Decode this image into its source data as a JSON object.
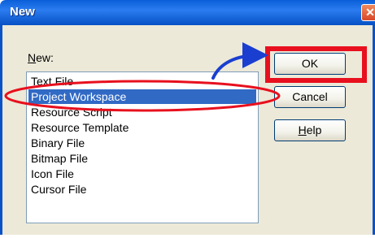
{
  "window": {
    "title": "New",
    "close_glyph": "✕"
  },
  "dialog": {
    "new_label_prefix": "N",
    "new_label_rest": "ew:",
    "list_items": [
      "Text File",
      "Project Workspace",
      "Resource Script",
      "Resource Template",
      "Binary File",
      "Bitmap File",
      "Icon File",
      "Cursor File"
    ],
    "selected_index": 1
  },
  "buttons": {
    "ok": "OK",
    "cancel": "Cancel",
    "help_prefix": "H",
    "help_rest": "elp"
  },
  "annotation": {
    "highlight_color": "#e8101e",
    "arrow_color": "#1a3fd0"
  }
}
